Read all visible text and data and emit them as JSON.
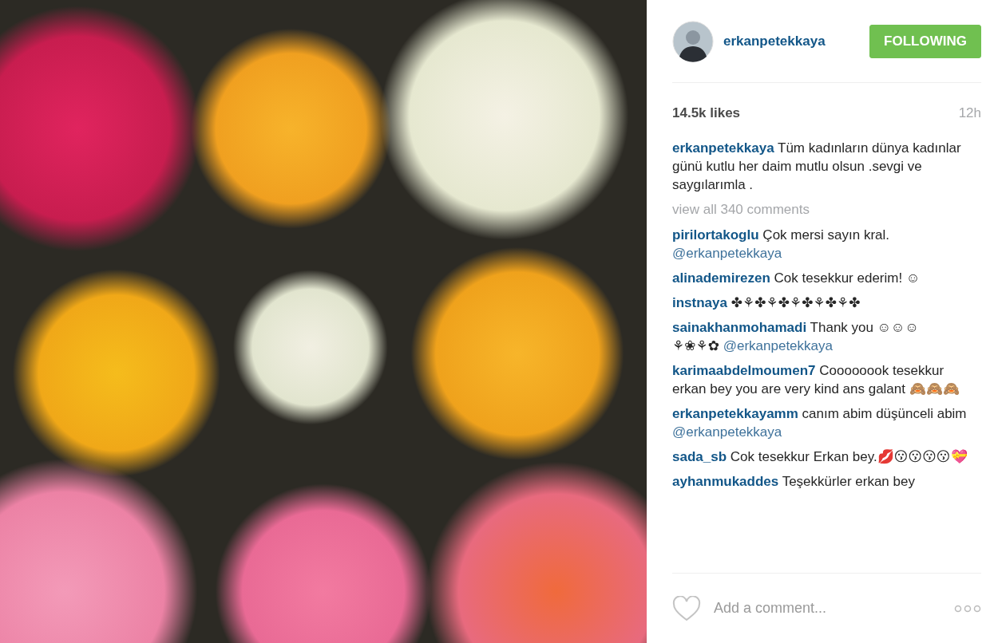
{
  "post": {
    "author": "erkanpetekkaya",
    "follow_button": {
      "label": "FOLLOWING",
      "selected": true
    },
    "likes": "14.5k likes",
    "time": "12h",
    "caption": {
      "user": "erkanpetekkaya",
      "text": "Tüm kadınların dünya kadınlar günü kutlu her daim mutlu olsun .sevgi ve saygılarımla ."
    },
    "view_all": "view all 340 comments",
    "comments": [
      {
        "user": "pirilortakoglu",
        "text": "Çok mersi sayın kral.",
        "mention": "@erkanpetekkaya"
      },
      {
        "user": "alinademirezen",
        "text": "Cok tesekkur ederim! ☺"
      },
      {
        "user": "instnaya",
        "text": "✤⚘✤⚘✤⚘✤⚘✤⚘✤"
      },
      {
        "user": "sainakhanmohamadi",
        "text": "Thank you ☺☺☺ ⚘❀⚘✿",
        "mention": "@erkanpetekkaya"
      },
      {
        "user": "karimaabdelmoumen7",
        "text": "Coooooook tesekkur erkan bey you are very kind ans galant 🙈🙈🙈"
      },
      {
        "user": "erkanpetekkayamm",
        "text": "canım abim düşünceli abim",
        "mention": "@erkanpetekkaya"
      },
      {
        "user": "sada_sb",
        "text": "Cok tesekkur Erkan bey.💋😗😗😗😗💝"
      },
      {
        "user": "ayhanmukaddes",
        "text": "Teşekkürler erkan bey"
      }
    ],
    "comment_field": {
      "placeholder": "Add a comment..."
    }
  }
}
